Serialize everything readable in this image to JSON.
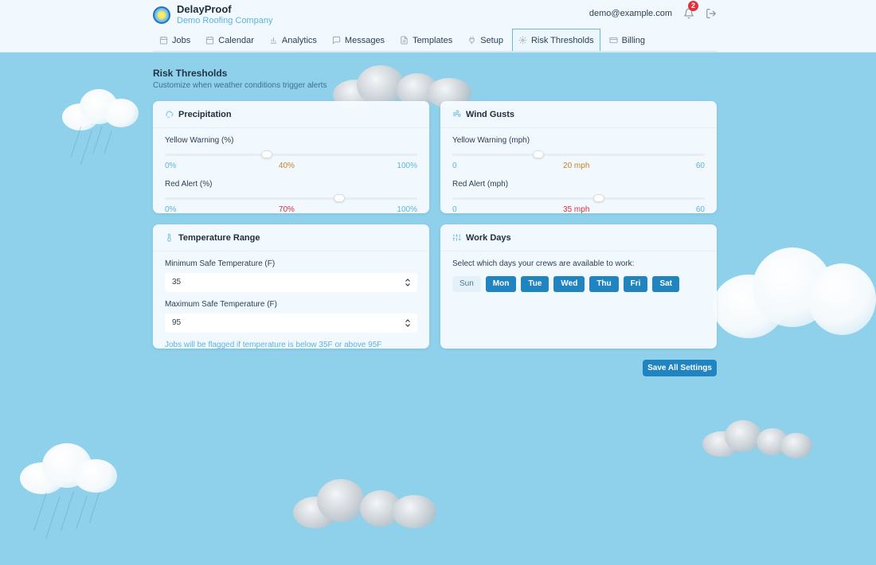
{
  "app": {
    "name": "DelayProof",
    "company": "Demo Roofing Company",
    "user_email": "demo@example.com",
    "notification_count": "2"
  },
  "nav": {
    "tabs": [
      {
        "label": "Jobs",
        "icon": "calendar-icon"
      },
      {
        "label": "Calendar",
        "icon": "calendar-icon"
      },
      {
        "label": "Analytics",
        "icon": "bar-chart-icon"
      },
      {
        "label": "Messages",
        "icon": "message-icon"
      },
      {
        "label": "Templates",
        "icon": "document-icon"
      },
      {
        "label": "Setup",
        "icon": "plug-icon"
      },
      {
        "label": "Risk Thresholds",
        "icon": "gear-icon",
        "active": true
      },
      {
        "label": "Billing",
        "icon": "credit-card-icon"
      }
    ]
  },
  "page": {
    "title": "Risk Thresholds",
    "subtitle": "Customize when weather conditions trigger alerts"
  },
  "precipitation": {
    "title": "Precipitation",
    "yellow": {
      "label": "Yellow Warning (%)",
      "min": "0%",
      "max": "100%",
      "value_text": "40%",
      "value": 40,
      "range": [
        0,
        100
      ]
    },
    "red": {
      "label": "Red Alert (%)",
      "min": "0%",
      "max": "100%",
      "value_text": "70%",
      "value": 70,
      "range": [
        0,
        100
      ]
    }
  },
  "wind": {
    "title": "Wind Gusts",
    "yellow": {
      "label": "Yellow Warning (mph)",
      "min": "0",
      "max": "60",
      "value_text": "20 mph",
      "value": 20,
      "range": [
        0,
        60
      ]
    },
    "red": {
      "label": "Red Alert (mph)",
      "min": "0",
      "max": "60",
      "value_text": "35 mph",
      "value": 35,
      "range": [
        0,
        60
      ]
    }
  },
  "temperature": {
    "title": "Temperature Range",
    "min_label": "Minimum Safe Temperature (F)",
    "min_value": "35",
    "max_label": "Maximum Safe Temperature (F)",
    "max_value": "95",
    "hint": "Jobs will be flagged if temperature is below 35F or above 95F"
  },
  "workdays": {
    "title": "Work Days",
    "prompt": "Select which days your crews are available to work:",
    "days": [
      {
        "label": "Sun",
        "selected": false
      },
      {
        "label": "Mon",
        "selected": true
      },
      {
        "label": "Tue",
        "selected": true
      },
      {
        "label": "Wed",
        "selected": true
      },
      {
        "label": "Thu",
        "selected": true
      },
      {
        "label": "Fri",
        "selected": true
      },
      {
        "label": "Sat",
        "selected": true
      }
    ]
  },
  "actions": {
    "save_label": "Save All Settings"
  },
  "colors": {
    "sky": "#8fd0eb",
    "primary": "#1f84c0",
    "yellow_value": "#c7802a",
    "red_value": "#d0323f",
    "accent_text": "#5ab3df"
  }
}
